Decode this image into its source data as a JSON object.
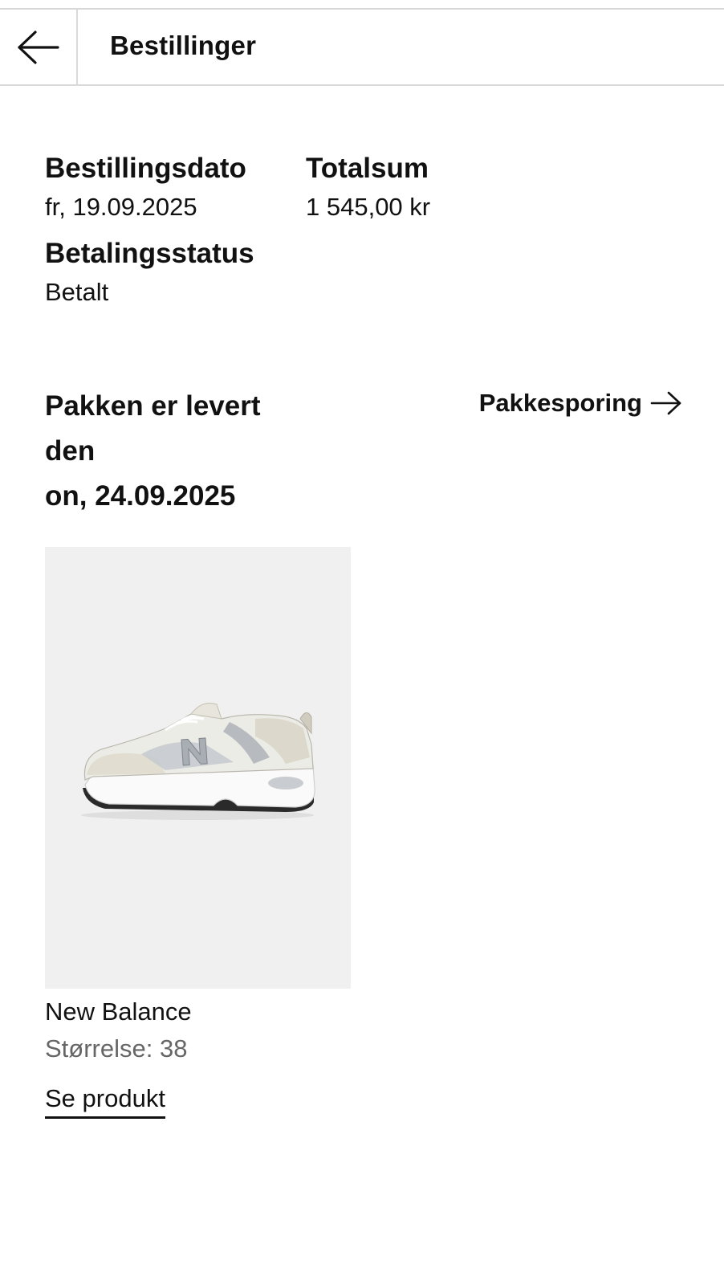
{
  "header": {
    "title": "Bestillinger",
    "back_icon": "arrow-left-icon"
  },
  "order": {
    "date_label": "Bestillingsdato",
    "date_value": "fr, 19.09.2025",
    "total_label": "Totalsum",
    "total_value": "1 545,00 kr",
    "payment_label": "Betalingsstatus",
    "payment_value": "Betalt"
  },
  "delivery": {
    "title_line1": "Pakken er levert",
    "title_line2": "den",
    "title_line3": "on, 24.09.2025",
    "tracking_label": "Pakkesporing",
    "tracking_icon": "arrow-right-icon"
  },
  "product": {
    "image_icon": "sneaker-image",
    "brand": "New Balance",
    "size": "Størrelse: 38",
    "link_label": "Se produkt"
  }
}
